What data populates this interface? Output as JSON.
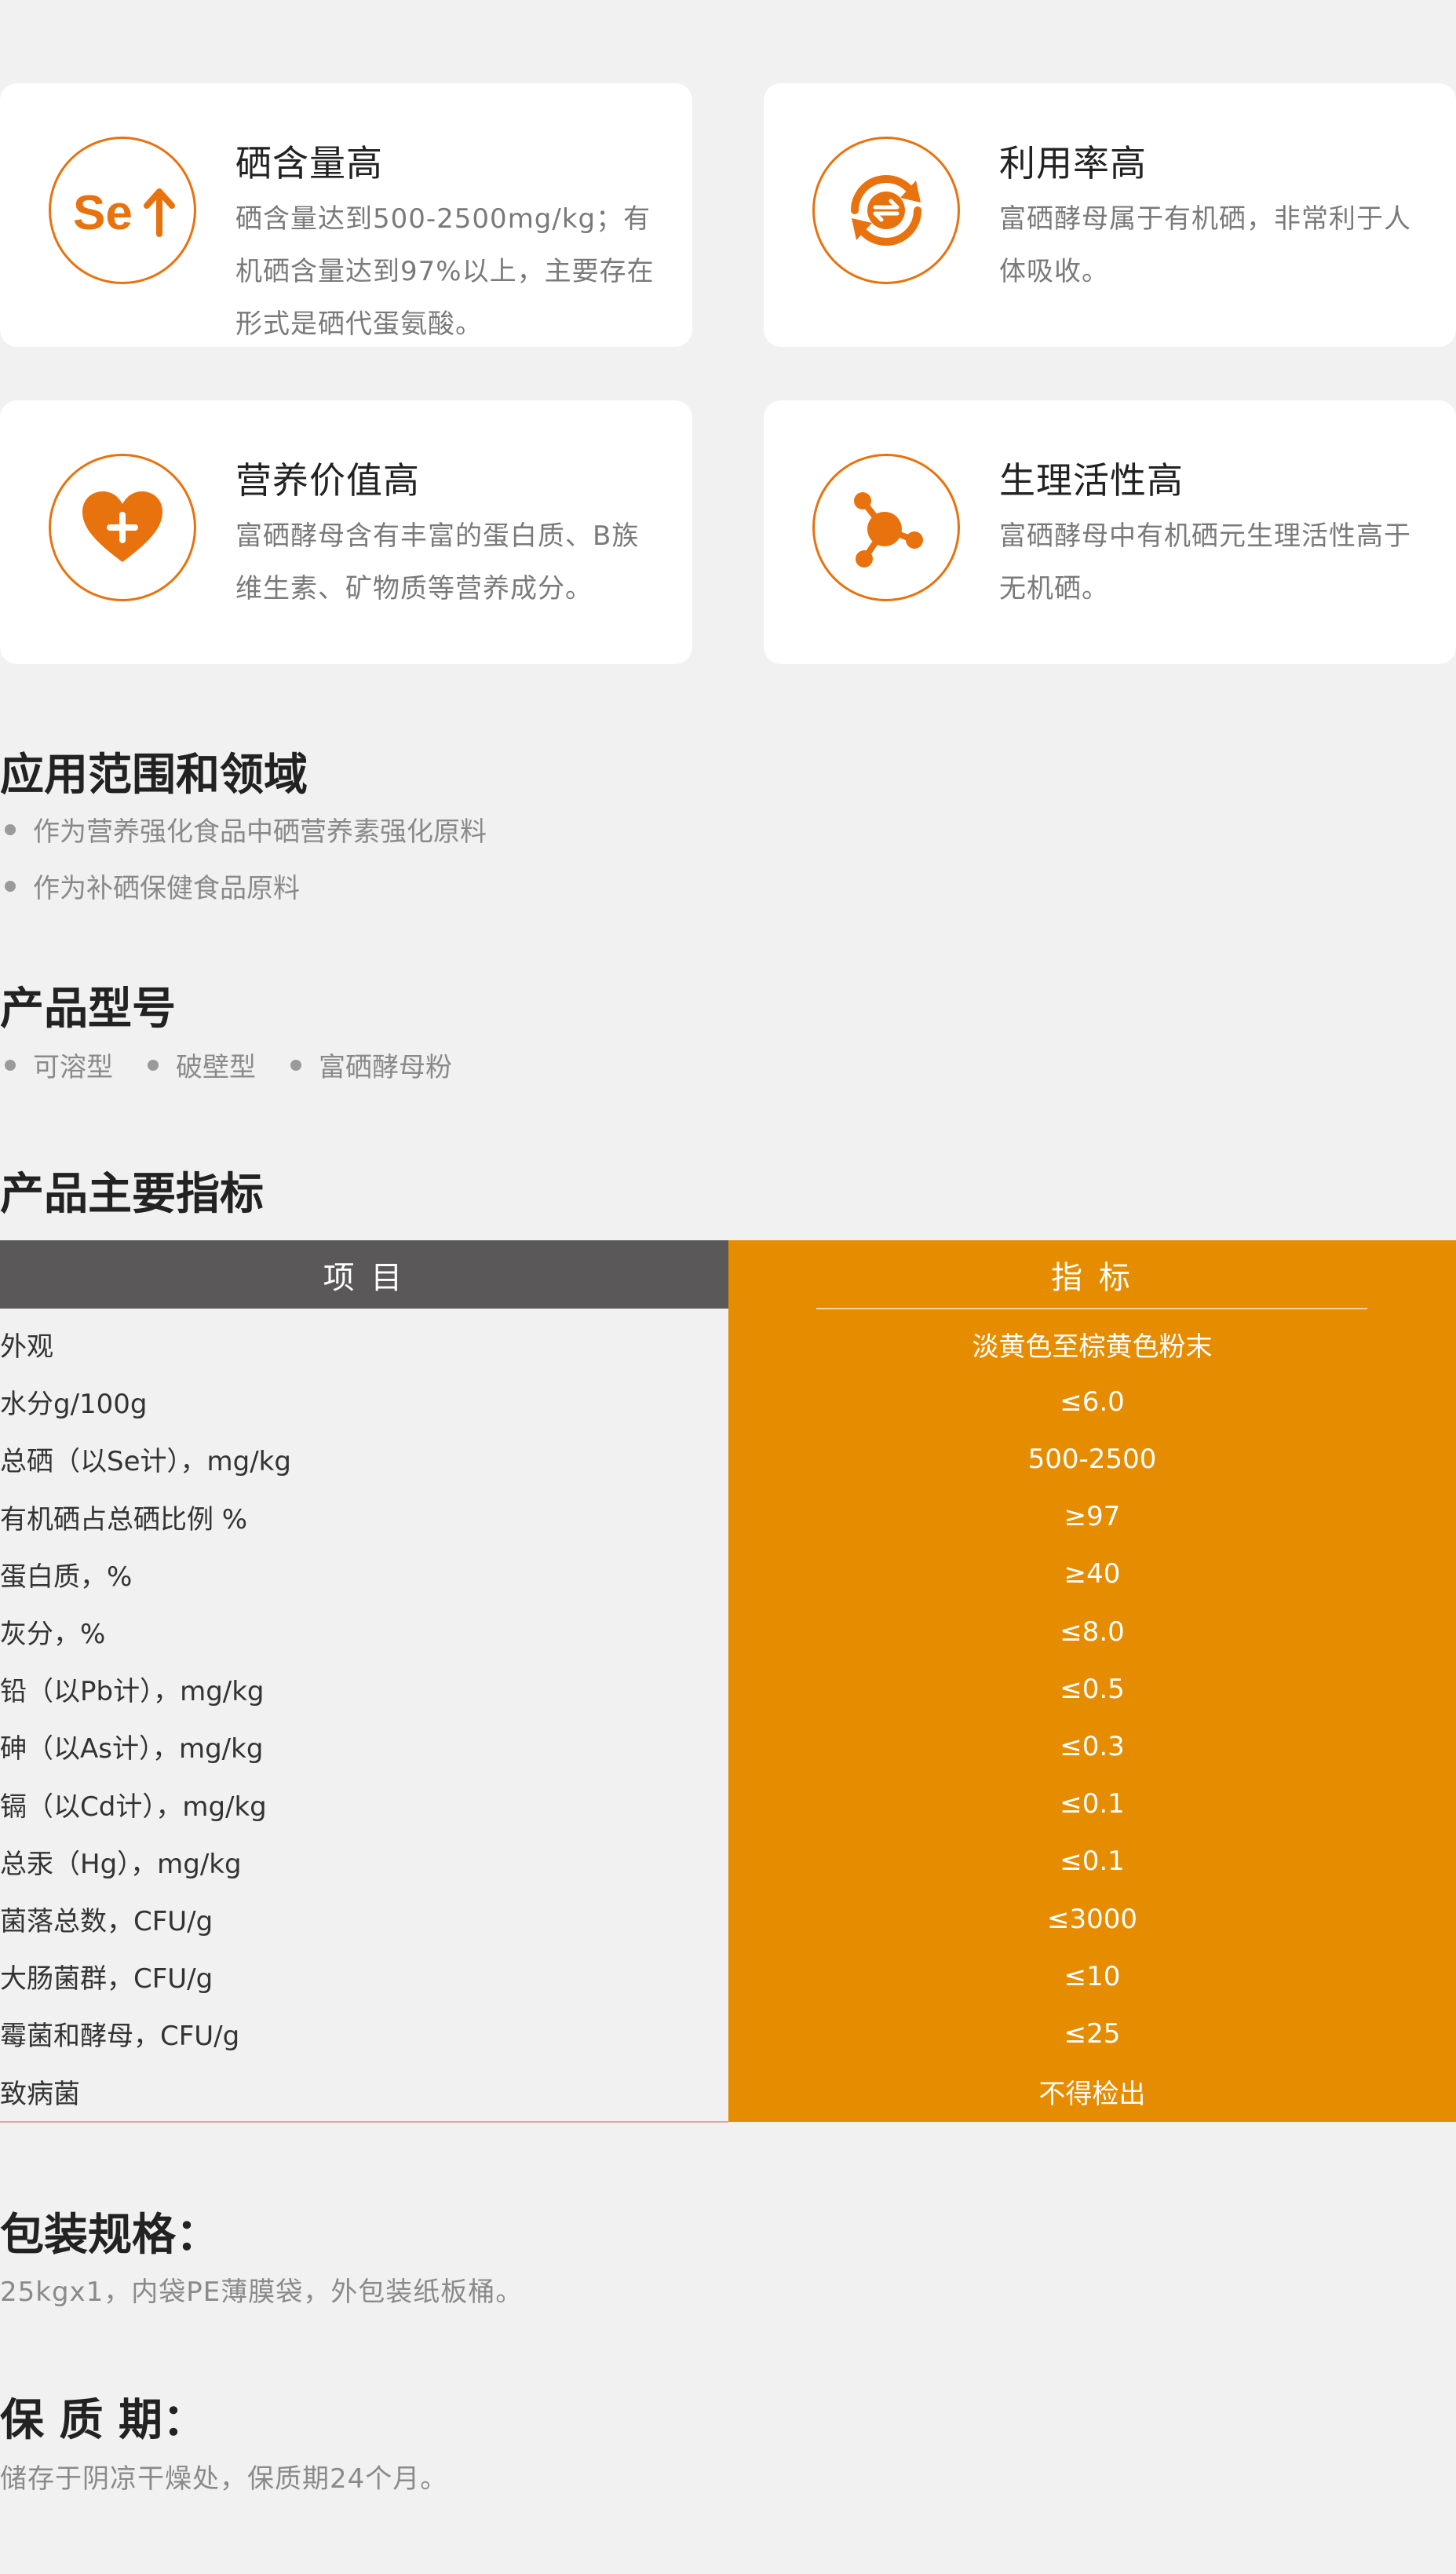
{
  "features": [
    {
      "title": "硒含量高",
      "desc": "硒含量达到500-2500mg/kg；有机硒含量达到97%以上，主要存在形式是硒代蛋氨酸。",
      "icon": "selenium-up-icon"
    },
    {
      "title": "利用率高",
      "desc": "富硒酵母属于有机硒，非常利于人体吸收。",
      "icon": "recycle-icon"
    },
    {
      "title": "营养价值高",
      "desc": "富硒酵母含有丰富的蛋白质、B族维生素、矿物质等营养成分。",
      "icon": "heart-plus-icon"
    },
    {
      "title": "生理活性高",
      "desc": "富硒酵母中有机硒元生理活性高于无机硒。",
      "icon": "molecule-icon"
    }
  ],
  "icon_text": {
    "se": "Se"
  },
  "colors": {
    "accent": "#e8720d",
    "table_orange": "#e68c00",
    "table_head_gray": "#5a5859"
  },
  "application": {
    "title": "应用范围和领域",
    "items": [
      "作为营养强化食品中硒营养素强化原料",
      "作为补硒保健食品原料"
    ]
  },
  "models": {
    "title": "产品型号",
    "items": [
      "可溶型",
      "破壁型",
      "富硒酵母粉"
    ]
  },
  "specs": {
    "title": "产品主要指标",
    "headers": [
      "项 目",
      "指 标"
    ],
    "rows": [
      [
        "外观",
        "淡黄色至棕黄色粉末"
      ],
      [
        "水分g/100g",
        "≤6.0"
      ],
      [
        "总硒（以Se计），mg/kg",
        "500-2500"
      ],
      [
        "有机硒占总硒比例 %",
        "≥97"
      ],
      [
        "蛋白质，%",
        "≥40"
      ],
      [
        "灰分，%",
        "≤8.0"
      ],
      [
        "铅（以Pb计），mg/kg",
        "≤0.5"
      ],
      [
        "砷（以As计），mg/kg",
        "≤0.3"
      ],
      [
        "镉（以Cd计），mg/kg",
        "≤0.1"
      ],
      [
        "总汞（Hg），mg/kg",
        "≤0.1"
      ],
      [
        "菌落总数，CFU/g",
        "≤3000"
      ],
      [
        "大肠菌群，CFU/g",
        "≤10"
      ],
      [
        "霉菌和酵母，CFU/g",
        "≤25"
      ],
      [
        "致病菌",
        "不得检出"
      ]
    ]
  },
  "packaging": {
    "title": "包装规格：",
    "text": "25kgx1，内袋PE薄膜袋，外包装纸板桶。"
  },
  "shelf_life": {
    "title": "保 质 期：",
    "text": "储存于阴凉干燥处，保质期24个月。"
  }
}
